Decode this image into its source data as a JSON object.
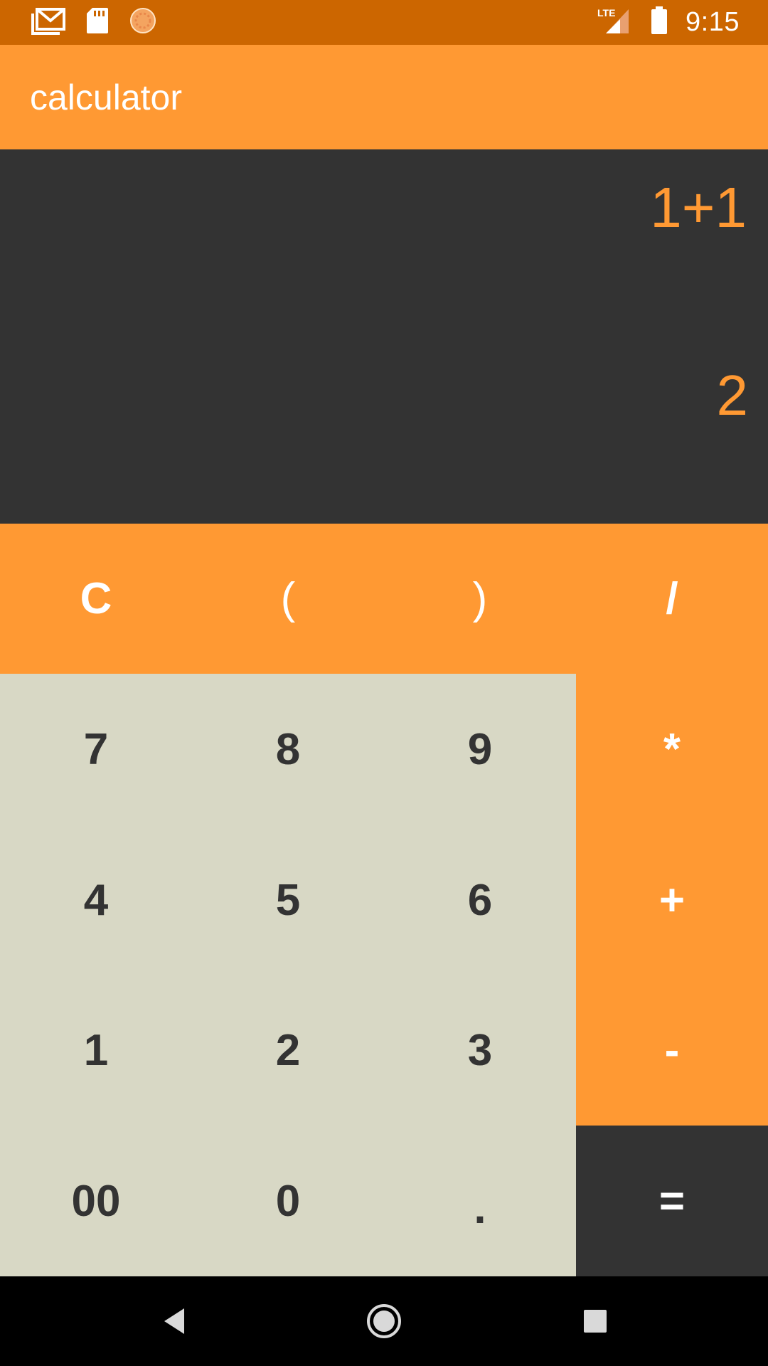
{
  "status_bar": {
    "time": "9:15",
    "network": "LTE",
    "icons": [
      "gmail-icon",
      "sd-card-icon",
      "sync-icon",
      "lte-signal-icon",
      "battery-icon"
    ]
  },
  "app_bar": {
    "title": "calculator"
  },
  "display": {
    "expression": "1+1",
    "result": "2"
  },
  "keys": {
    "clear": "C",
    "open_paren": "(",
    "close_paren": ")",
    "divide": "/",
    "seven": "7",
    "eight": "8",
    "nine": "9",
    "multiply": "*",
    "four": "4",
    "five": "5",
    "six": "6",
    "plus": "+",
    "one": "1",
    "two": "2",
    "three": "3",
    "minus": "-",
    "double_zero": "00",
    "zero": "0",
    "dot": ".",
    "equals": "="
  },
  "nav_bar": {
    "icons": [
      "back-icon",
      "home-icon",
      "recents-icon"
    ]
  },
  "colors": {
    "status_bar": "#CC6600",
    "accent": "#FF9933",
    "display_bg": "#333333",
    "keypad_bg": "#D8D8C5"
  }
}
